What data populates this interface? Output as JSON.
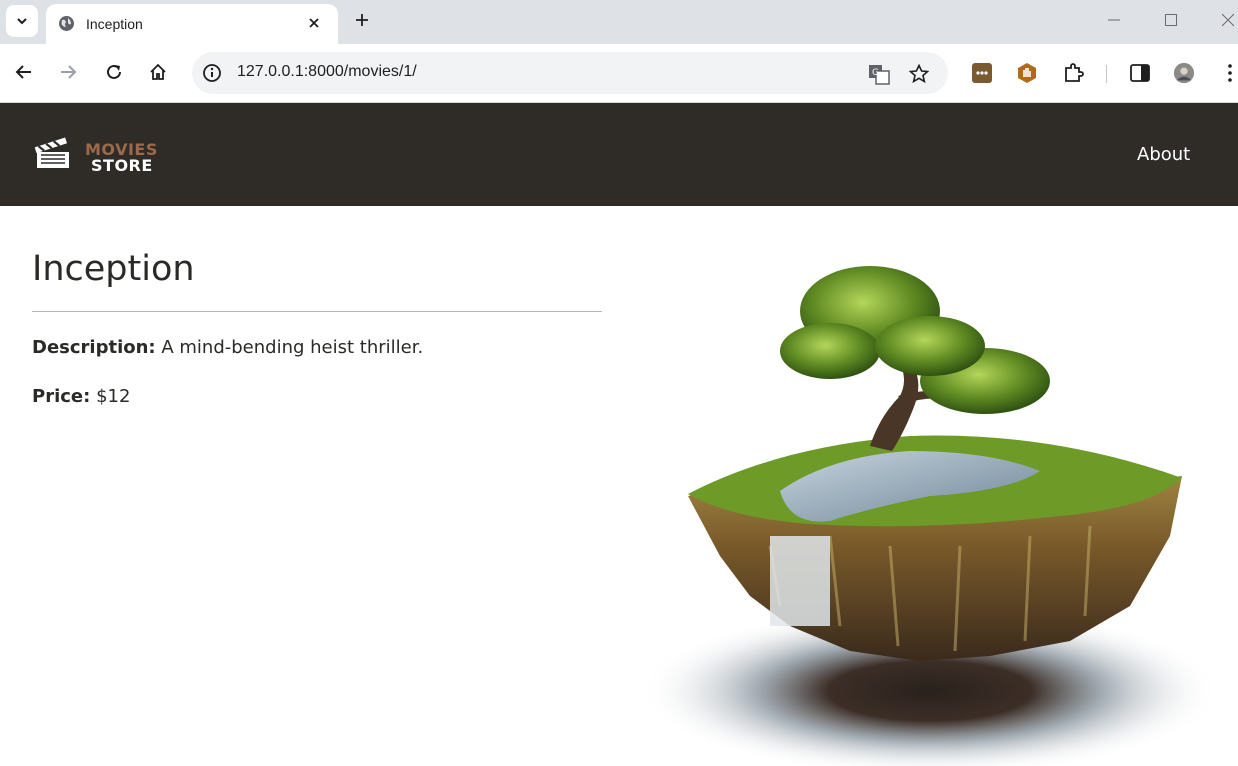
{
  "browser": {
    "tab_title": "Inception",
    "url": "127.0.0.1:8000/movies/1/"
  },
  "site": {
    "logo_top": "MOVIES",
    "logo_bottom": "STORE",
    "nav_about": "About"
  },
  "movie": {
    "title": "Inception",
    "description_label": "Description:",
    "description": "A mind-bending heist thriller.",
    "price_label": "Price:",
    "price": "$12"
  },
  "colors": {
    "navbar": "#2f2c28",
    "logo_accent": "#9a6a4a",
    "text": "#2b2a27"
  },
  "icons": {
    "extensions": [
      "menu-extension-icon",
      "hand-extension-icon",
      "puzzle-icon"
    ]
  }
}
